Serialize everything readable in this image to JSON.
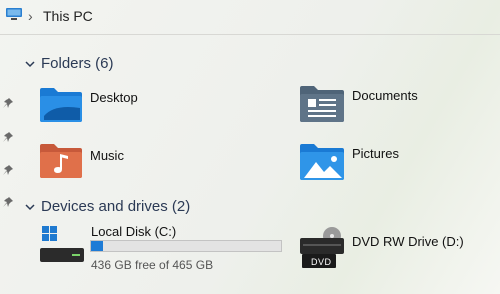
{
  "address": {
    "location": "This PC"
  },
  "folders_section": {
    "title": "Folders (6)"
  },
  "folders": [
    {
      "label": "Desktop"
    },
    {
      "label": "Documents"
    },
    {
      "label": "Music"
    },
    {
      "label": "Pictures"
    }
  ],
  "devices_section": {
    "title": "Devices and drives (2)"
  },
  "drives": {
    "local": {
      "label": "Local Disk (C:)",
      "free_text": "436 GB free of 465 GB",
      "used_fraction": 0.0624
    },
    "dvd": {
      "label": "DVD RW Drive (D:)",
      "badge": "DVD"
    }
  },
  "colors": {
    "accent": "#1e7bd6",
    "section_text": "#2b3a55"
  }
}
